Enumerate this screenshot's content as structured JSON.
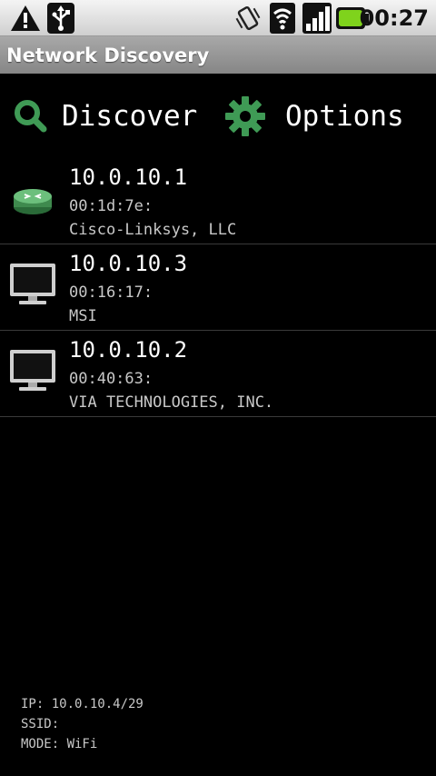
{
  "status_bar": {
    "time": "00:27",
    "icons": [
      "warning-icon",
      "usb-icon",
      "vibrate-icon",
      "wifi-icon",
      "signal-icon",
      "battery-icon"
    ]
  },
  "app": {
    "title": "Network Discovery"
  },
  "toolbar": {
    "discover_label": "Discover",
    "options_label": "Options"
  },
  "devices": [
    {
      "ip": "10.0.10.1",
      "mac": "00:1d:7e:",
      "vendor": "Cisco-Linksys, LLC",
      "icon": "router-icon"
    },
    {
      "ip": "10.0.10.3",
      "mac": "00:16:17:",
      "vendor": "MSI",
      "icon": "monitor-icon"
    },
    {
      "ip": "10.0.10.2",
      "mac": "00:40:63:",
      "vendor": "VIA TECHNOLOGIES, INC.",
      "icon": "monitor-icon"
    }
  ],
  "footer": {
    "ip": "IP: 10.0.10.4/29",
    "ssid": "SSID:",
    "mode": "MODE: WiFi"
  },
  "colors": {
    "status_bar_bg": "#dedede",
    "title_bar_bg": "#979797",
    "background": "#000000",
    "accent_green": "#3f9a55",
    "battery_green": "#7fd31c",
    "separator": "#3a3a3a"
  }
}
